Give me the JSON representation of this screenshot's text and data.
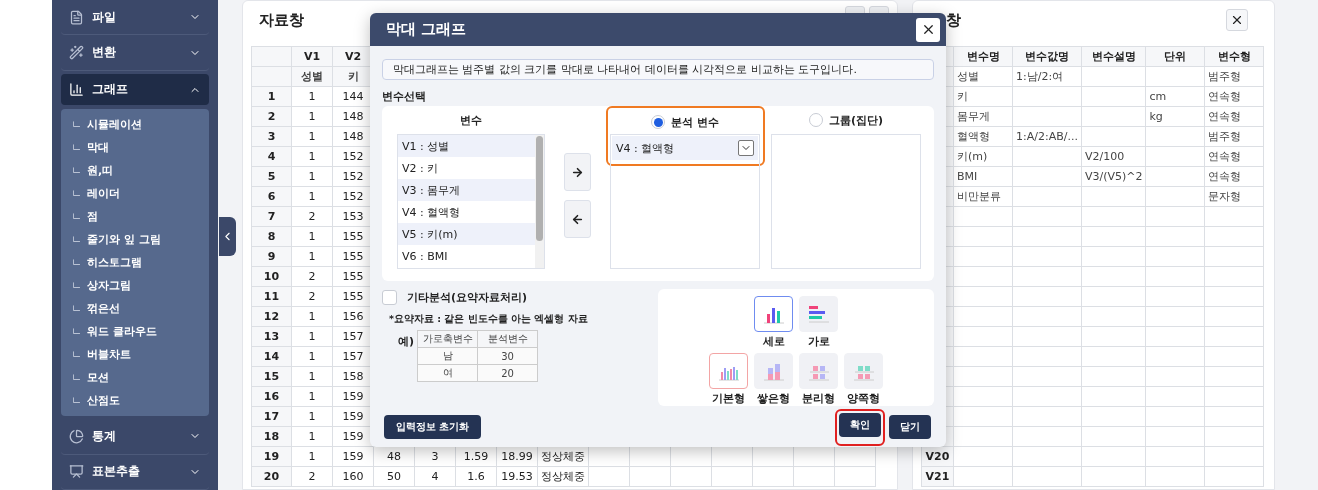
{
  "sidebar": {
    "items": [
      {
        "label": "파일",
        "expanded": false,
        "selected": false
      },
      {
        "label": "변환",
        "expanded": false,
        "selected": false
      },
      {
        "label": "그래프",
        "expanded": true,
        "selected": true,
        "children": [
          {
            "bullet": "ㄴ",
            "label": "시뮬레이션"
          },
          {
            "bullet": "ㄴ",
            "label": "막대"
          },
          {
            "bullet": "ㄴ",
            "label": "원,띠"
          },
          {
            "bullet": "ㄴ",
            "label": "레이더"
          },
          {
            "bullet": "ㄴ",
            "label": "점"
          },
          {
            "bullet": "ㄴ",
            "label": "줄기와 잎 그림"
          },
          {
            "bullet": "ㄴ",
            "label": "히스토그램"
          },
          {
            "bullet": "ㄴ",
            "label": "상자그림"
          },
          {
            "bullet": "ㄴ",
            "label": "꺾은선"
          },
          {
            "bullet": "ㄴ",
            "label": "워드 클라우드"
          },
          {
            "bullet": "ㄴ",
            "label": "버블차트"
          },
          {
            "bullet": "ㄴ",
            "label": "모션"
          },
          {
            "bullet": "ㄴ",
            "label": "산점도"
          }
        ]
      },
      {
        "label": "통계",
        "expanded": false,
        "selected": false
      },
      {
        "label": "표본추출",
        "expanded": false,
        "selected": false
      }
    ]
  },
  "data_window": {
    "title": "자료창",
    "columns": [
      {
        "name": "V1",
        "label": "성별"
      },
      {
        "name": "V2",
        "label": "키"
      }
    ],
    "rows": [
      {
        "index": "1",
        "cells": [
          "1",
          "144"
        ]
      },
      {
        "index": "2",
        "cells": [
          "1",
          "148"
        ]
      },
      {
        "index": "3",
        "cells": [
          "1",
          "148"
        ]
      },
      {
        "index": "4",
        "cells": [
          "1",
          "152"
        ]
      },
      {
        "index": "5",
        "cells": [
          "1",
          "152"
        ]
      },
      {
        "index": "6",
        "cells": [
          "1",
          "152"
        ]
      },
      {
        "index": "7",
        "cells": [
          "2",
          "153"
        ]
      },
      {
        "index": "8",
        "cells": [
          "1",
          "155"
        ]
      },
      {
        "index": "9",
        "cells": [
          "1",
          "155"
        ]
      },
      {
        "index": "10",
        "cells": [
          "2",
          "155"
        ]
      },
      {
        "index": "11",
        "cells": [
          "2",
          "155"
        ]
      },
      {
        "index": "12",
        "cells": [
          "1",
          "156"
        ]
      },
      {
        "index": "13",
        "cells": [
          "1",
          "157"
        ]
      },
      {
        "index": "14",
        "cells": [
          "1",
          "157"
        ]
      },
      {
        "index": "15",
        "cells": [
          "1",
          "158"
        ]
      },
      {
        "index": "16",
        "cells": [
          "1",
          "159"
        ]
      },
      {
        "index": "17",
        "cells": [
          "1",
          "159"
        ]
      },
      {
        "index": "18",
        "cells": [
          "1",
          "159"
        ]
      },
      {
        "index": "19",
        "cells": [
          "1",
          "159",
          "48",
          "3",
          "1.59",
          "18.99",
          "정상체중"
        ]
      },
      {
        "index": "20",
        "cells": [
          "2",
          "160",
          "50",
          "4",
          "1.6",
          "19.53",
          "정상체중"
        ]
      }
    ]
  },
  "variable_window": {
    "title": "창",
    "columns": [
      "변수명",
      "변수값명",
      "변수설명",
      "단위",
      "변수형"
    ],
    "rows": [
      {
        "name": "성별",
        "value_labels": "1:남/2:여",
        "type": "범주형"
      },
      {
        "name": "키",
        "unit": "cm",
        "type": "연속형"
      },
      {
        "name": "몸무게",
        "unit": "kg",
        "type": "연속형"
      },
      {
        "name": "혈액형",
        "value_labels": "1:A/2:AB/...",
        "type": "범주형"
      },
      {
        "name": "키(m)",
        "description": "V2/100",
        "type": "연속형"
      },
      {
        "name": "BMI",
        "description": "V3/(V5)^2",
        "type": "연속형"
      },
      {
        "name": "비만분류",
        "type": "문자형"
      }
    ],
    "trailing_rows": [
      {
        "label": "V20"
      },
      {
        "label": "V21"
      }
    ]
  },
  "dialog": {
    "title": "막대 그래프",
    "description": "막대그래프는 범주별 값의 크기를 막대로 나타내어 데이터를 시각적으로 비교하는 도구입니다.",
    "section_label": "변수선택",
    "variable_list": {
      "heading": "변수",
      "items": [
        "V1 : 성별",
        "V2 : 키",
        "V3 : 몸무게",
        "V4 : 혈액형",
        "V5 : 키(m)",
        "V6 : BMI"
      ]
    },
    "targets": [
      {
        "label": "분석 변수",
        "selected": true,
        "highlighted": true,
        "items": [
          "V4 : 혈액형"
        ]
      },
      {
        "label": "그룹(집단)",
        "selected": false,
        "highlighted": false
      }
    ],
    "summary": {
      "label": "기타분석(요약자료처리)",
      "checked": false,
      "note": "*요약자료 : 같은 빈도수를 아는 엑셀형 자료",
      "example_label": "예)",
      "example_table": {
        "columns": [
          "가로축변수",
          "분석변수"
        ],
        "rows": [
          [
            "남",
            "30"
          ],
          [
            "여",
            "20"
          ]
        ]
      }
    },
    "orientations": [
      {
        "kind": "vertical",
        "label": "세로",
        "selected": true
      },
      {
        "kind": "horizontal",
        "label": "가로",
        "selected": false
      }
    ],
    "styles": [
      {
        "kind": "basic",
        "label": "기본형",
        "selected": true
      },
      {
        "kind": "stacked",
        "label": "쌓은형",
        "selected": false
      },
      {
        "kind": "split",
        "label": "분리형",
        "selected": false
      },
      {
        "kind": "both",
        "label": "양쪽형",
        "selected": false
      }
    ],
    "buttons": [
      {
        "kind": "reset",
        "label": "입력정보 초기화",
        "highlighted": false
      },
      {
        "kind": "confirm",
        "label": "확인",
        "highlighted": true
      },
      {
        "kind": "close",
        "label": "닫기",
        "highlighted": false
      }
    ]
  }
}
